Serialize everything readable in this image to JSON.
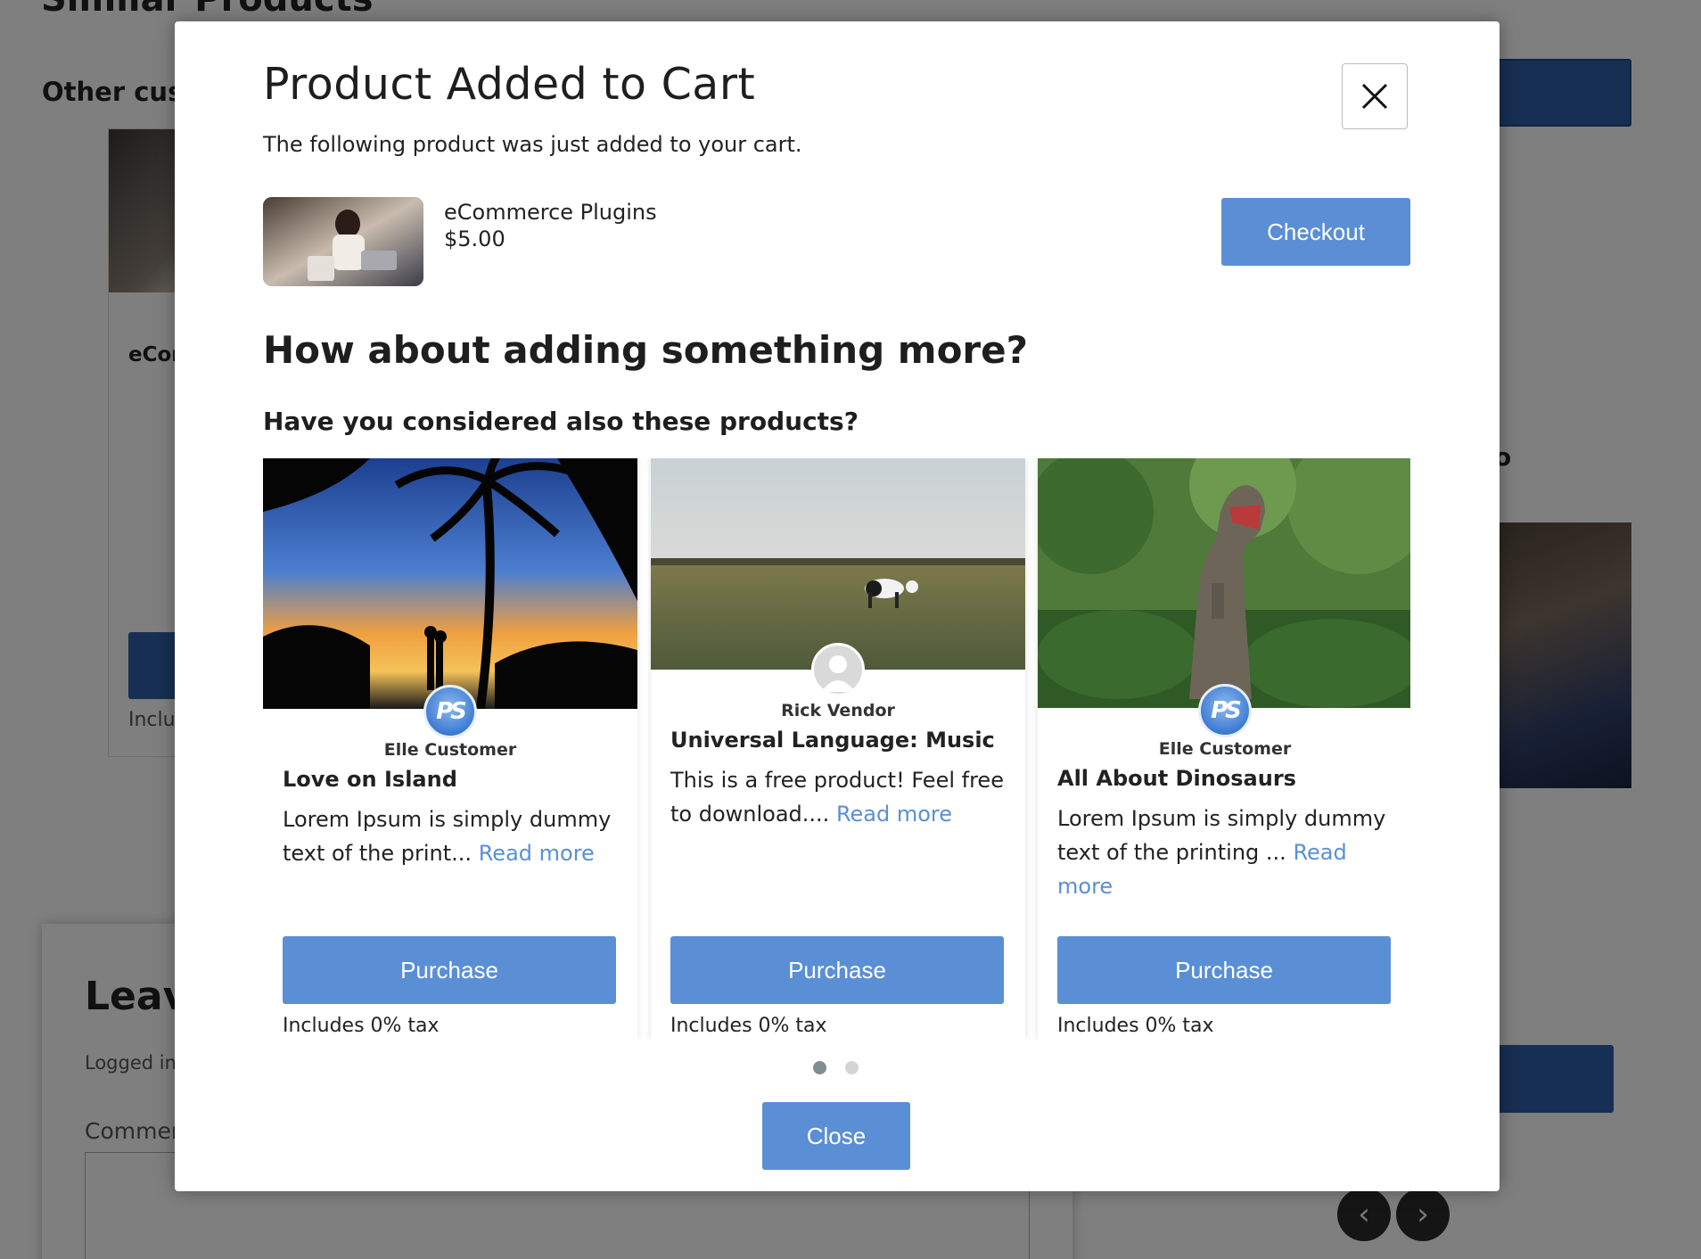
{
  "background": {
    "heading": "Similar Products",
    "subheading": "Other cust",
    "card_title": "eCor",
    "card_tax": "Inclu",
    "right_letter": "o",
    "leave_heading": "Leav",
    "logged_in": "Logged in",
    "comment_label": "Commer",
    "arrow_prev": "‹",
    "arrow_next": "›"
  },
  "modal": {
    "title": "Product Added to Cart",
    "subtitle": "The following product was just added to your cart.",
    "added_product": {
      "name": "eCommerce Plugins",
      "price": "$5.00"
    },
    "checkout_label": "Checkout",
    "upsell_heading": "How about adding something more?",
    "upsell_subheading": "Have you considered also these products?",
    "products": [
      {
        "vendor": "Elle Customer",
        "title": "Love on Island",
        "description": "Lorem Ipsum is simply dummy text of the print...",
        "read_more": "Read more",
        "purchase_label": "Purchase",
        "tax": "Includes 0% tax",
        "avatar": "PS"
      },
      {
        "vendor": "Rick Vendor",
        "title": "Universal Language: Music",
        "description": "This is a free product! Feel free to download....",
        "read_more": "Read more",
        "purchase_label": "Purchase",
        "tax": "Includes 0% tax",
        "avatar": "user-icon"
      },
      {
        "vendor": "Elle Customer",
        "title": "All About Dinosaurs",
        "description": "Lorem Ipsum is simply dummy text of the printing ...",
        "read_more": "Read more",
        "purchase_label": "Purchase",
        "tax": "Includes 0% tax",
        "avatar": "PS"
      }
    ],
    "carousel_pages": 2,
    "carousel_active_page": 1,
    "close_label": "Close"
  },
  "colors": {
    "primary_button": "#5a8fd6",
    "link": "#5a8fd6",
    "overlay": "rgba(0,0,0,0.5)"
  }
}
